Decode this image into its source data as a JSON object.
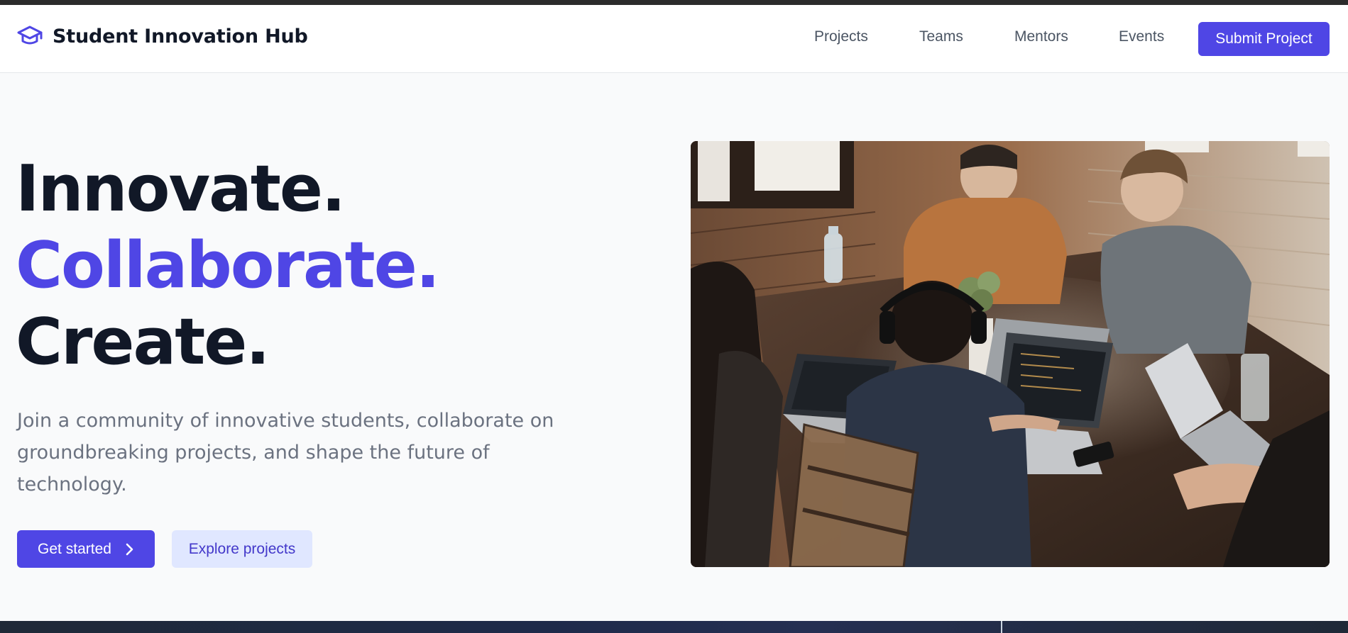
{
  "header": {
    "brand_name": "Student Innovation Hub",
    "brand_icon": "graduation-cap-icon",
    "nav": [
      {
        "label": "Projects"
      },
      {
        "label": "Teams"
      },
      {
        "label": "Mentors"
      },
      {
        "label": "Events"
      }
    ],
    "cta_label": "Submit Project"
  },
  "hero": {
    "headline": [
      "Innovate.",
      "Collaborate.",
      "Create."
    ],
    "subtext": "Join a community of innovative students, collaborate on groundbreaking projects, and shape the future of technology.",
    "primary_button": {
      "label": "Get started",
      "icon": "chevron-right-icon"
    },
    "secondary_button": {
      "label": "Explore projects"
    },
    "image_icon": "students-collaborating-photo"
  },
  "colors": {
    "accent": "#4f46e5",
    "heading": "#111827",
    "body_text": "#6b7280",
    "nav_text": "#4b5563",
    "secondary_button_bg": "#e0e7ff",
    "page_bg": "#f9fafb"
  }
}
